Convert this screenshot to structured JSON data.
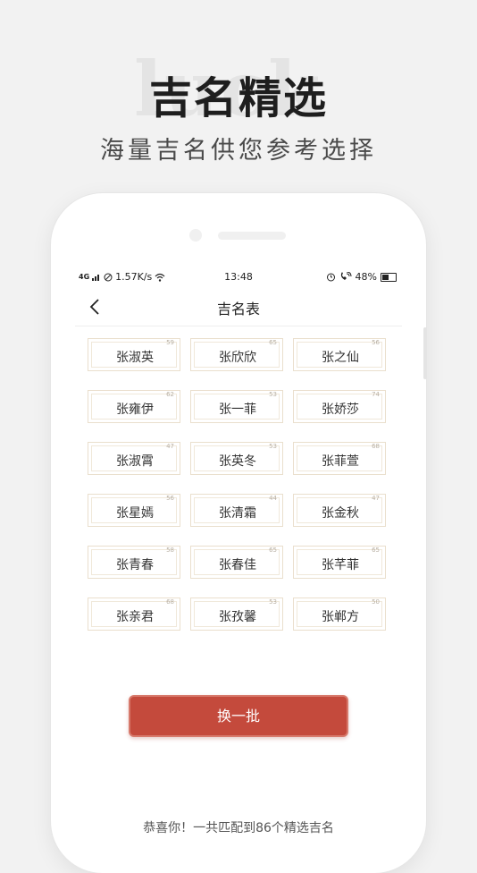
{
  "promo": {
    "bg_word": "luck",
    "title": "吉名精选",
    "subtitle": "海量吉名供您参考选择"
  },
  "status_bar": {
    "signal": "4G",
    "speed": "1.57K/s",
    "time": "13:48",
    "battery": "48%"
  },
  "nav": {
    "title": "吉名表"
  },
  "names": [
    {
      "name": "张淑英",
      "score": "59"
    },
    {
      "name": "张欣欣",
      "score": "65"
    },
    {
      "name": "张之仙",
      "score": "56"
    },
    {
      "name": "张雍伊",
      "score": "62"
    },
    {
      "name": "张一菲",
      "score": "53"
    },
    {
      "name": "张娇莎",
      "score": "74"
    },
    {
      "name": "张淑霄",
      "score": "47"
    },
    {
      "name": "张英冬",
      "score": "53"
    },
    {
      "name": "张菲萱",
      "score": "68"
    },
    {
      "name": "张星嫣",
      "score": "56"
    },
    {
      "name": "张清霜",
      "score": "44"
    },
    {
      "name": "张金秋",
      "score": "47"
    },
    {
      "name": "张青春",
      "score": "58"
    },
    {
      "name": "张春佳",
      "score": "65"
    },
    {
      "name": "张芊菲",
      "score": "65"
    },
    {
      "name": "张亲君",
      "score": "68"
    },
    {
      "name": "张孜馨",
      "score": "53"
    },
    {
      "name": "张郸方",
      "score": "50"
    }
  ],
  "refresh_label": "换一批",
  "footer": "恭喜你！一共匹配到86个精选吉名"
}
